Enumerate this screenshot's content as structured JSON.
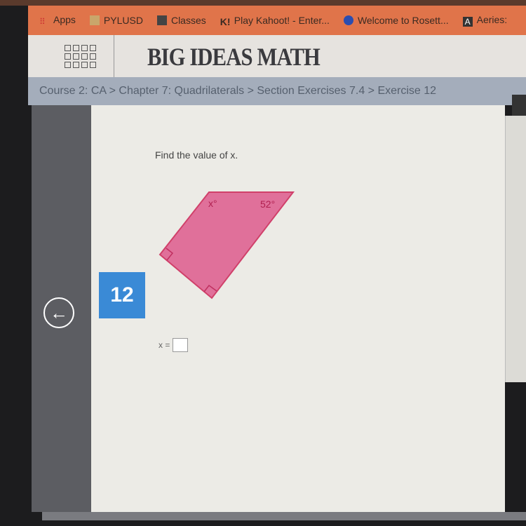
{
  "bookmarks": [
    {
      "label": "Apps",
      "icon": "apps-grid-icon"
    },
    {
      "label": "PYLUSD",
      "icon": "folder-icon"
    },
    {
      "label": "Classes",
      "icon": "classes-icon"
    },
    {
      "label": "Play Kahoot! - Enter...",
      "icon": "kahoot-icon"
    },
    {
      "label": "Welcome to Rosett...",
      "icon": "rosetta-icon"
    },
    {
      "label": "Aeries:",
      "icon": "aeries-icon"
    }
  ],
  "header": {
    "logo": "BIG IDEAS MATH"
  },
  "breadcrumb": "Course 2: CA > Chapter 7: Quadrilaterals > Section Exercises 7.4 > Exercise 12",
  "exercise": {
    "number": "12",
    "question": "Find the value of x.",
    "angle_x": "x°",
    "angle_given": "52°",
    "answer_label": "x =",
    "answer_value": "",
    "shape_color": "#e0709a"
  },
  "nav": {
    "back_icon": "←"
  }
}
